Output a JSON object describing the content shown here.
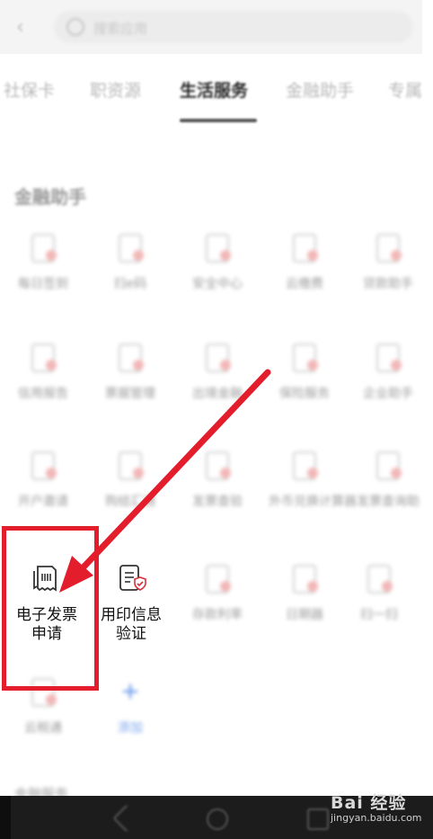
{
  "header": {
    "search_placeholder": "搜索应用",
    "back_icon": "chevron-left-icon",
    "search_icon": "search-icon"
  },
  "tabs": [
    {
      "label": "社保卡"
    },
    {
      "label": "职资源"
    },
    {
      "label": "生活服务",
      "active": true
    },
    {
      "label": "金融助手"
    },
    {
      "label": "专属服"
    }
  ],
  "section": {
    "title": "金融助手"
  },
  "grid": [
    {
      "label": "每日签到"
    },
    {
      "label": "扫e码"
    },
    {
      "label": "安全中心"
    },
    {
      "label": "云缴费"
    },
    {
      "label": "贷款助手"
    },
    {
      "label": "信用报告"
    },
    {
      "label": "票据管理"
    },
    {
      "label": "出境金融"
    },
    {
      "label": "保险服务"
    },
    {
      "label": "企业助手"
    },
    {
      "label": "开户邀请"
    },
    {
      "label": "购结汇通"
    },
    {
      "label": "发票查验"
    },
    {
      "label": "外币兑换计算器"
    },
    {
      "label": "发票查询助"
    },
    {
      "label": "电子发票申请",
      "highlight": true
    },
    {
      "label": "用印信息验证"
    },
    {
      "label": "存款利率"
    },
    {
      "label": "日期器"
    },
    {
      "label": "扫一扫"
    },
    {
      "label": "云税通"
    },
    {
      "label": "添加"
    }
  ],
  "bottom": {
    "partial_label": "金融服务"
  },
  "watermark": {
    "brand": "Bai 经验",
    "url": "jingyan.baidu.com"
  },
  "colors": {
    "annotation_red": "#e31d2b",
    "nav_bar": "#1c1c1c"
  }
}
